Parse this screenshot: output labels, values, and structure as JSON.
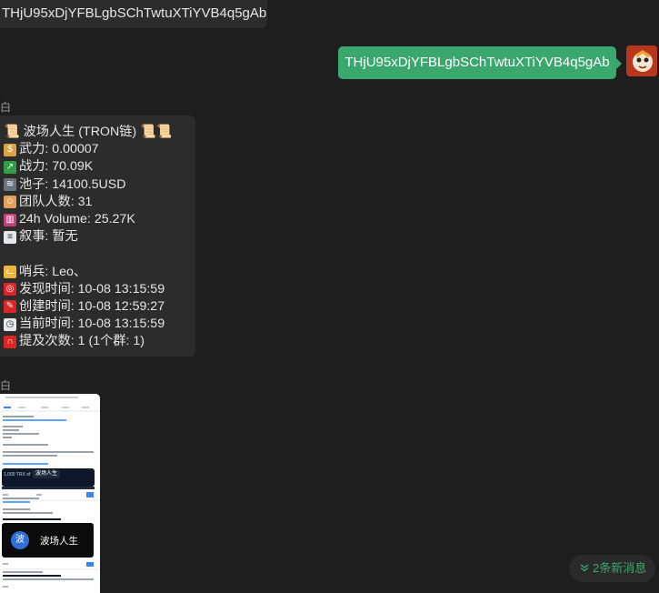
{
  "messages": {
    "top_partial": "THjU95xDjYFBLgbSChTwtuXTiYVB4q5gAb",
    "my_bubble": "THjU95xDjYFBLgbSChTwtuXTiYVB4q5gAb",
    "sender_1": "白",
    "sender_2": "白"
  },
  "card": {
    "title": "📜 波场人生 (TRON链) 📜📜",
    "rows": [
      {
        "icon": "money-bag-icon",
        "text": "武力: 0.00007"
      },
      {
        "icon": "chart-up-icon",
        "text": "战力: 70.09K"
      },
      {
        "icon": "pool-icon",
        "text": "池子: 14100.5USD"
      },
      {
        "icon": "team-icon",
        "text": "团队人数: 31"
      },
      {
        "icon": "bar-chart-icon",
        "text": "24h Volume: 25.27K"
      },
      {
        "icon": "memo-icon",
        "text": "叙事: 暂无"
      }
    ],
    "rows2": [
      {
        "icon": "cat-icon",
        "text": "哨兵: Leo、"
      },
      {
        "icon": "target-icon",
        "text": "发现时间: 10-08 13:15:59"
      },
      {
        "icon": "pin-icon",
        "text": "创建时间: 10-08 12:59:27"
      },
      {
        "icon": "clock-icon",
        "text": "当前时间: 10-08 13:15:59"
      },
      {
        "icon": "magnet-icon",
        "text": "提及次数: 1 (1个群: 1)"
      }
    ]
  },
  "screenshot": {
    "token_label": "波场人生",
    "token_initial": "波",
    "trx_label": "1,000 TRX of",
    "token_tag": "波场人生"
  },
  "new_messages": "2条新消息",
  "colors": {
    "accent": "#3aa76d",
    "background": "#1e1e1e",
    "bubble": "#2c2c2c"
  }
}
